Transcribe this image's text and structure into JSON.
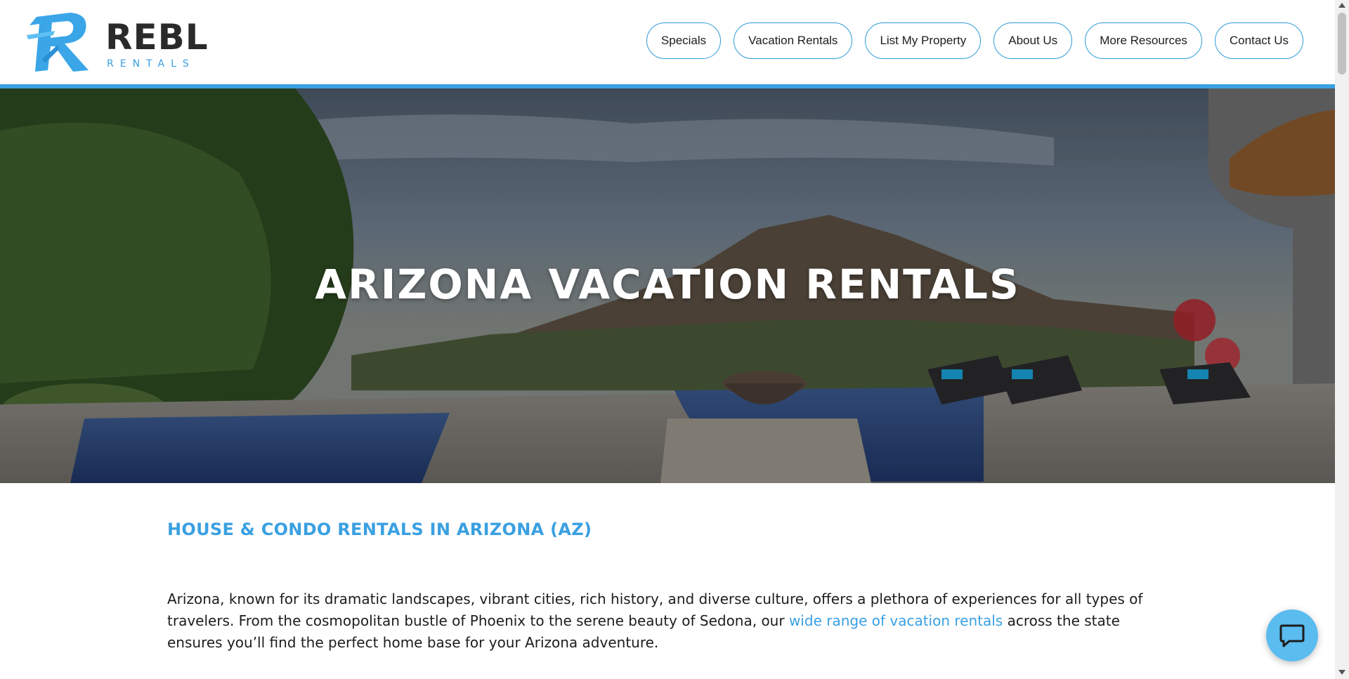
{
  "brand": {
    "name": "REBL",
    "tagline": "RENTALS",
    "accent_color": "#3aa0e2"
  },
  "nav": {
    "items": [
      {
        "label": "Specials"
      },
      {
        "label": "Vacation Rentals"
      },
      {
        "label": "List My Property"
      },
      {
        "label": "About Us"
      },
      {
        "label": "More Resources"
      },
      {
        "label": "Contact Us"
      }
    ]
  },
  "hero": {
    "title": "ARIZONA VACATION RENTALS"
  },
  "main": {
    "heading": "HOUSE & CONDO RENTALS IN ARIZONA (AZ)",
    "intro_before_link": "Arizona, known for its dramatic landscapes, vibrant cities, rich history, and diverse culture, offers a plethora of experiences for all types of travelers. From the cosmopolitan bustle of Phoenix to the serene beauty of Sedona, our ",
    "intro_link": "wide range of vacation rentals",
    "intro_after_link": " across the state ensures you’ll find the perfect home base for your Arizona adventure."
  },
  "icons": {
    "logo": "rebl-logo-icon",
    "chat": "chat-bubble-icon",
    "scroll_up": "scroll-up-arrow-icon",
    "scroll_down": "scroll-down-arrow-icon"
  }
}
